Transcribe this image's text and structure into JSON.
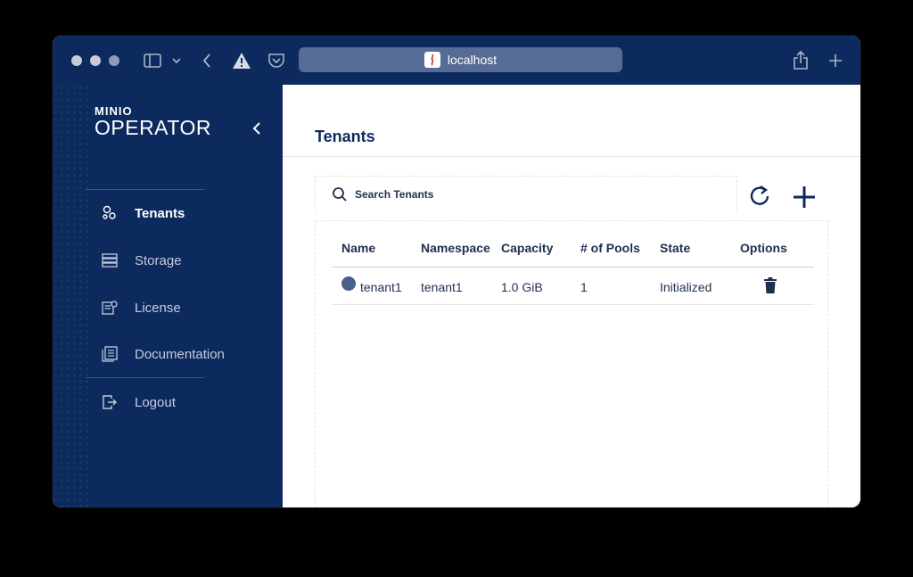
{
  "browser": {
    "url": "localhost",
    "icons": [
      "sidebar-toggle-icon",
      "chevron-down-icon",
      "back-arrow-icon",
      "warning-icon",
      "pocket-icon",
      "share-icon",
      "new-tab-plus-icon"
    ]
  },
  "sidebar": {
    "logo_top": "MINIO",
    "logo_bottom": "OPERATOR",
    "items": [
      {
        "label": "Tenants",
        "icon": "tenants-icon",
        "active": true
      },
      {
        "label": "Storage",
        "icon": "storage-icon",
        "active": false
      },
      {
        "label": "License",
        "icon": "license-icon",
        "active": false
      },
      {
        "label": "Documentation",
        "icon": "documentation-icon",
        "active": false
      },
      {
        "label": "Logout",
        "icon": "logout-icon",
        "active": false
      }
    ]
  },
  "main": {
    "title": "Tenants",
    "search_placeholder": "Search Tenants",
    "table": {
      "columns": [
        "Name",
        "Namespace",
        "Capacity",
        "# of Pools",
        "State",
        "Options"
      ],
      "rows": [
        {
          "name": "tenant1",
          "namespace": "tenant1",
          "capacity": "1.0 GiB",
          "pools": "1",
          "state": "Initialized"
        }
      ]
    }
  },
  "colors": {
    "navy": "#0d2a5e",
    "text": "#1e2f4f",
    "urlbar": "#566b95",
    "status_dot": "#4b6088"
  }
}
